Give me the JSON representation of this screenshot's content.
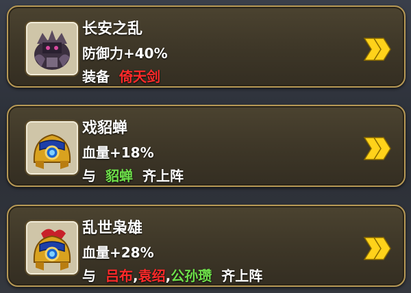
{
  "cards": [
    {
      "title": "长安之乱",
      "effect": "防御力+40%",
      "req_prefix": "装备",
      "req_items": [
        "倚天剑"
      ],
      "req_item_color": "#ff2a2a",
      "portrait_icon": "dark-armor-general-icon"
    },
    {
      "title": "戏貂蝉",
      "effect": "血量+18%",
      "req_prefix": "与",
      "req_items": [
        "貂蝉"
      ],
      "req_item_color": "#6ee04a",
      "req_suffix": "齐上阵",
      "portrait_icon": "golden-helmet-icon"
    },
    {
      "title": "乱世枭雄",
      "effect": "血量+28%",
      "req_prefix": "与",
      "req_items": [
        "吕布",
        "袁绍",
        "公孙瓒"
      ],
      "req_item_colors": [
        "#ff2a2a",
        "#ff2a2a",
        "#6ee04a"
      ],
      "req_separator": ",",
      "req_suffix": "齐上阵",
      "portrait_icon": "golden-helmet-red-plume-icon"
    }
  ],
  "colors": {
    "card_border": "#b89a56",
    "card_bg": "#3d3627",
    "chevron": "#ffd21a"
  }
}
